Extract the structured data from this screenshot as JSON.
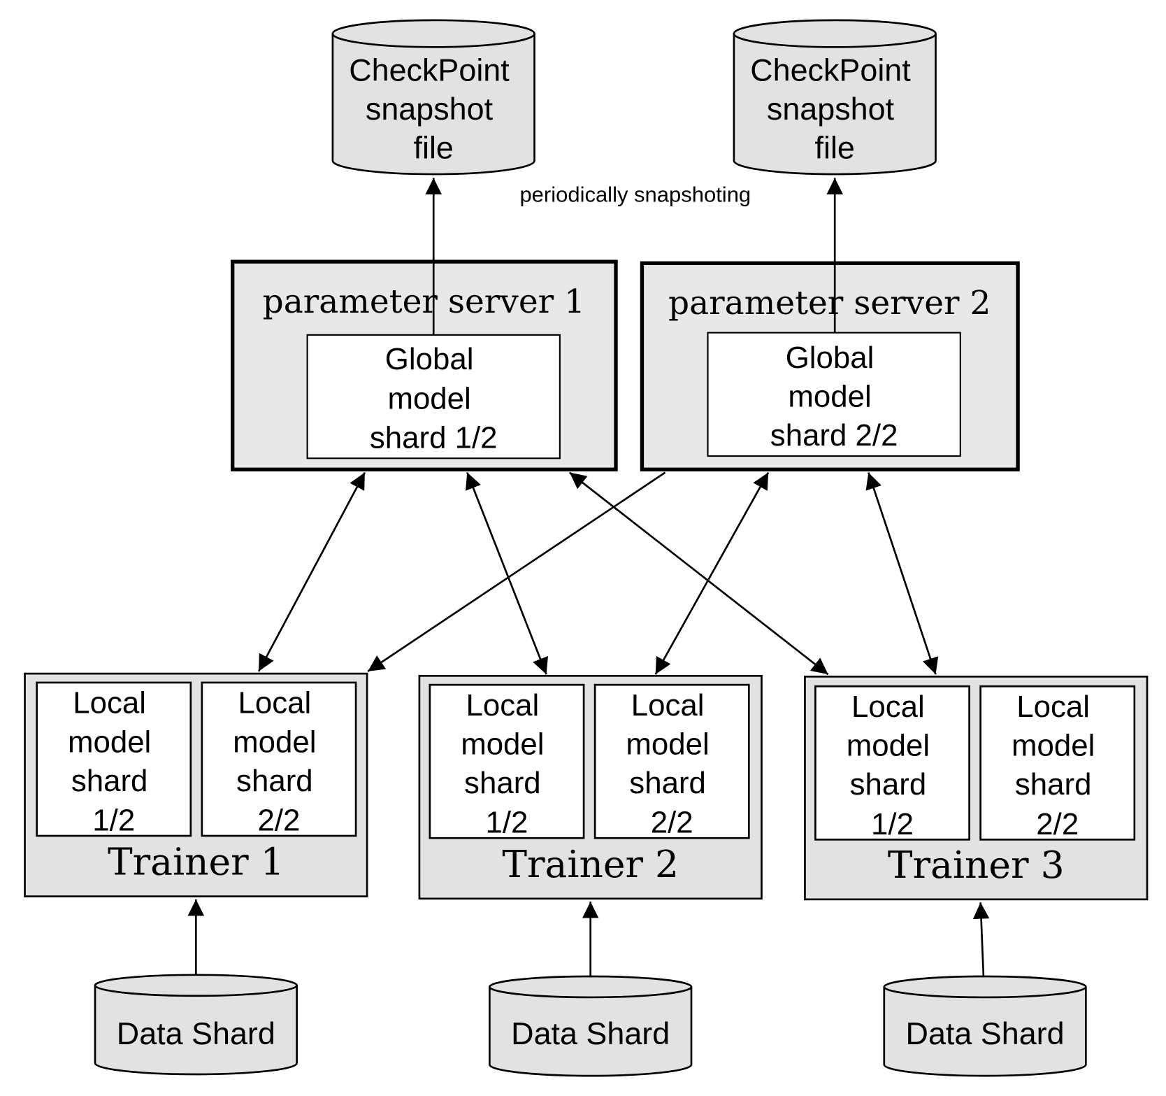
{
  "colors": {
    "cylinder_fill": "#e2e2e2",
    "server_fill": "#e8e8e8",
    "trainer_fill": "#e2e2e2",
    "shard_fill": "#ffffff",
    "stroke": "#000000"
  },
  "checkpoints": [
    {
      "lines": [
        "CheckPoint",
        "snapshot",
        "file"
      ]
    },
    {
      "lines": [
        "CheckPoint",
        "snapshot",
        "file"
      ]
    }
  ],
  "snapshot_label": "periodically snapshoting",
  "servers": [
    {
      "title": "parameter server 1",
      "shard_lines": [
        "Global",
        "model",
        "shard 1/2"
      ]
    },
    {
      "title": "parameter server 2",
      "shard_lines": [
        "Global",
        "model",
        "shard 2/2"
      ]
    }
  ],
  "trainers": [
    {
      "title": "Trainer 1",
      "shards": [
        [
          "Local",
          "model",
          "shard",
          "1/2"
        ],
        [
          "Local",
          "model",
          "shard",
          "2/2"
        ]
      ]
    },
    {
      "title": "Trainer 2",
      "shards": [
        [
          "Local",
          "model",
          "shard",
          "1/2"
        ],
        [
          "Local",
          "model",
          "shard",
          "2/2"
        ]
      ]
    },
    {
      "title": "Trainer 3",
      "shards": [
        [
          "Local",
          "model",
          "shard",
          "1/2"
        ],
        [
          "Local",
          "model",
          "shard",
          "2/2"
        ]
      ]
    }
  ],
  "data_shards": [
    {
      "label": "Data Shard"
    },
    {
      "label": "Data Shard"
    },
    {
      "label": "Data Shard"
    }
  ],
  "edges": [
    {
      "from": "parameter server 1",
      "to": "CheckPoint snapshot file 1",
      "type": "one-way"
    },
    {
      "from": "parameter server 2",
      "to": "CheckPoint snapshot file 2",
      "type": "one-way"
    },
    {
      "from": "parameter server 1",
      "to": "Trainer 1",
      "type": "bidirectional"
    },
    {
      "from": "parameter server 1",
      "to": "Trainer 2",
      "type": "bidirectional"
    },
    {
      "from": "parameter server 1",
      "to": "Trainer 3",
      "type": "bidirectional"
    },
    {
      "from": "parameter server 2",
      "to": "Trainer 1",
      "type": "one-way-to-trainer"
    },
    {
      "from": "parameter server 2",
      "to": "Trainer 2",
      "type": "bidirectional"
    },
    {
      "from": "parameter server 2",
      "to": "Trainer 3",
      "type": "bidirectional"
    },
    {
      "from": "Data Shard 1",
      "to": "Trainer 1",
      "type": "one-way"
    },
    {
      "from": "Data Shard 2",
      "to": "Trainer 2",
      "type": "one-way"
    },
    {
      "from": "Data Shard 3",
      "to": "Trainer 3",
      "type": "one-way"
    }
  ]
}
